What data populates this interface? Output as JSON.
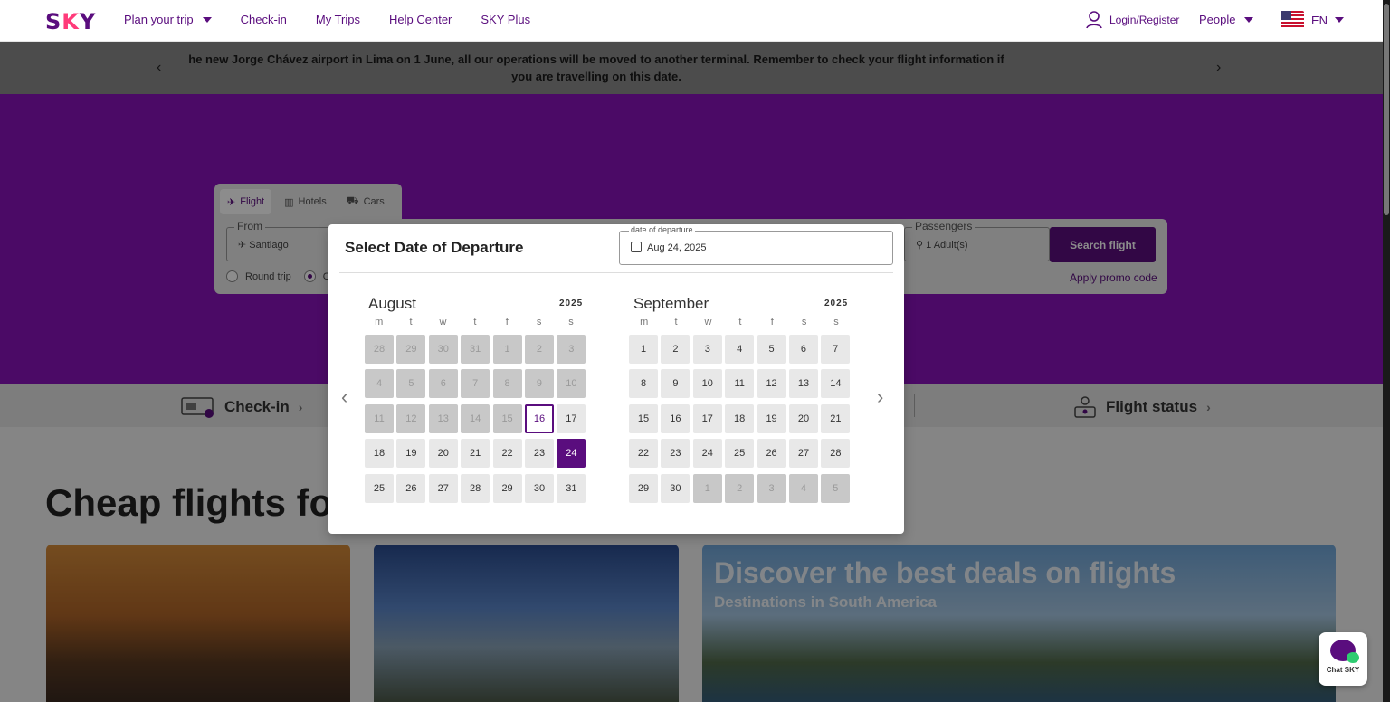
{
  "header": {
    "logo": "SKY",
    "nav": [
      "Plan your trip",
      "Check-in",
      "My Trips",
      "Help Center",
      "SKY Plus"
    ],
    "login": "Login/Register",
    "people": "People",
    "language": "EN"
  },
  "banner": {
    "text": "he new Jorge Chávez airport in Lima on 1 June, all our operations will be moved to another terminal. Remember to check your flight information if you are travelling on this date."
  },
  "search": {
    "tabs": [
      "Flight",
      "Hotels",
      "Cars"
    ],
    "from_legend": "From",
    "from_value": "Santiago",
    "passengers_legend": "Passengers",
    "passengers_value": "1 Adult(s)",
    "trip_round": "Round trip",
    "trip_one": "One",
    "search_button": "Search flight",
    "promo": "Apply promo code"
  },
  "picker": {
    "title": "Select Date of Departure",
    "departure_legend": "date of departure",
    "departure_value": "Aug 24, 2025",
    "weekdays": [
      "m",
      "t",
      "w",
      "t",
      "f",
      "s",
      "s"
    ],
    "months": [
      {
        "name": "August",
        "year": "2025",
        "days": [
          {
            "n": "28",
            "s": "out"
          },
          {
            "n": "29",
            "s": "out"
          },
          {
            "n": "30",
            "s": "out"
          },
          {
            "n": "31",
            "s": "out"
          },
          {
            "n": "1",
            "s": "past"
          },
          {
            "n": "2",
            "s": "past"
          },
          {
            "n": "3",
            "s": "past"
          },
          {
            "n": "4",
            "s": "past"
          },
          {
            "n": "5",
            "s": "past"
          },
          {
            "n": "6",
            "s": "past"
          },
          {
            "n": "7",
            "s": "past"
          },
          {
            "n": "8",
            "s": "past"
          },
          {
            "n": "9",
            "s": "past"
          },
          {
            "n": "10",
            "s": "past"
          },
          {
            "n": "11",
            "s": "past"
          },
          {
            "n": "12",
            "s": "past"
          },
          {
            "n": "13",
            "s": "past"
          },
          {
            "n": "14",
            "s": "past"
          },
          {
            "n": "15",
            "s": "past"
          },
          {
            "n": "16",
            "s": "today"
          },
          {
            "n": "17",
            "s": ""
          },
          {
            "n": "18",
            "s": ""
          },
          {
            "n": "19",
            "s": ""
          },
          {
            "n": "20",
            "s": ""
          },
          {
            "n": "21",
            "s": ""
          },
          {
            "n": "22",
            "s": ""
          },
          {
            "n": "23",
            "s": ""
          },
          {
            "n": "24",
            "s": "sel"
          },
          {
            "n": "25",
            "s": ""
          },
          {
            "n": "26",
            "s": ""
          },
          {
            "n": "27",
            "s": ""
          },
          {
            "n": "28",
            "s": ""
          },
          {
            "n": "29",
            "s": ""
          },
          {
            "n": "30",
            "s": ""
          },
          {
            "n": "31",
            "s": ""
          }
        ]
      },
      {
        "name": "September",
        "year": "2025",
        "days": [
          {
            "n": "1",
            "s": ""
          },
          {
            "n": "2",
            "s": ""
          },
          {
            "n": "3",
            "s": ""
          },
          {
            "n": "4",
            "s": ""
          },
          {
            "n": "5",
            "s": ""
          },
          {
            "n": "6",
            "s": ""
          },
          {
            "n": "7",
            "s": ""
          },
          {
            "n": "8",
            "s": ""
          },
          {
            "n": "9",
            "s": ""
          },
          {
            "n": "10",
            "s": ""
          },
          {
            "n": "11",
            "s": ""
          },
          {
            "n": "12",
            "s": ""
          },
          {
            "n": "13",
            "s": ""
          },
          {
            "n": "14",
            "s": ""
          },
          {
            "n": "15",
            "s": ""
          },
          {
            "n": "16",
            "s": ""
          },
          {
            "n": "17",
            "s": ""
          },
          {
            "n": "18",
            "s": ""
          },
          {
            "n": "19",
            "s": ""
          },
          {
            "n": "20",
            "s": ""
          },
          {
            "n": "21",
            "s": ""
          },
          {
            "n": "22",
            "s": ""
          },
          {
            "n": "23",
            "s": ""
          },
          {
            "n": "24",
            "s": ""
          },
          {
            "n": "25",
            "s": ""
          },
          {
            "n": "26",
            "s": ""
          },
          {
            "n": "27",
            "s": ""
          },
          {
            "n": "28",
            "s": ""
          },
          {
            "n": "29",
            "s": ""
          },
          {
            "n": "30",
            "s": ""
          },
          {
            "n": "1",
            "s": "out"
          },
          {
            "n": "2",
            "s": "out"
          },
          {
            "n": "3",
            "s": "out"
          },
          {
            "n": "4",
            "s": "out"
          },
          {
            "n": "5",
            "s": "out"
          }
        ]
      }
    ]
  },
  "quick": {
    "checkin": "Check-in",
    "flight_status": "Flight status"
  },
  "deals": {
    "cheap_title": "Cheap flights for y",
    "title": "Discover the best deals on flights",
    "subtitle": "Destinations in South America"
  },
  "chat": {
    "label": "Chat SKY"
  },
  "colors": {
    "brand": "#5a0d7e",
    "accent": "#ff3b7a"
  }
}
